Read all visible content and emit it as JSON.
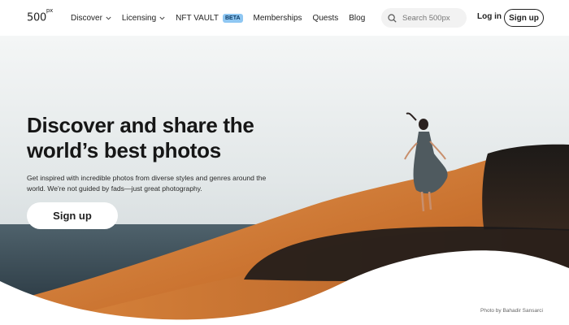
{
  "brand": {
    "logo": "500",
    "logo_sup": "px"
  },
  "nav": {
    "discover": "Discover",
    "licensing": "Licensing",
    "nft_vault": "NFT VAULT",
    "beta_badge": "BETA",
    "memberships": "Memberships",
    "quests": "Quests",
    "blog": "Blog"
  },
  "search": {
    "placeholder": "Search 500px",
    "icon": "search-icon"
  },
  "auth": {
    "login": "Log in",
    "signup": "Sign up"
  },
  "hero": {
    "headline_line1": "Discover and share the",
    "headline_line2": "world’s best photos",
    "subcopy_line1": "Get inspired with incredible photos from diverse styles and genres around the",
    "subcopy_line2": "world. We're not guided by fads—just great photography.",
    "signup": "Sign up",
    "photo_credit": "Photo by Bahadir Sansarci"
  },
  "colors": {
    "beta_bg": "#8fc7f2",
    "sand": "#d07a35",
    "sky": "#dfe4e6",
    "sea": "#3a4c57"
  }
}
